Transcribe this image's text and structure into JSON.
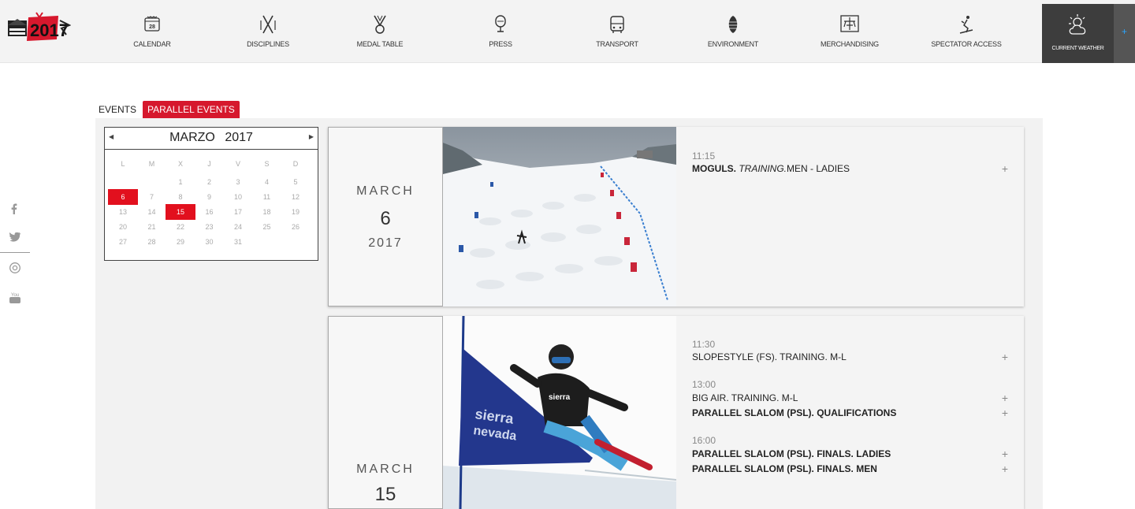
{
  "logo": {
    "text": "2017",
    "brand": "sierra nevada"
  },
  "nav": [
    {
      "label": "CALENDAR",
      "icon": "calendar-icon",
      "badge": "28"
    },
    {
      "label": "DISCIPLINES",
      "icon": "skis-icon"
    },
    {
      "label": "MEDAL TABLE",
      "icon": "medal-icon"
    },
    {
      "label": "PRESS",
      "icon": "microphone-icon"
    },
    {
      "label": "TRANSPORT",
      "icon": "bus-icon"
    },
    {
      "label": "ENVIRONMENT",
      "icon": "pinecone-icon"
    },
    {
      "label": "MERCHANDISING",
      "icon": "shop-icon"
    },
    {
      "label": "SPECTATOR ACCESS",
      "icon": "skier-icon"
    }
  ],
  "weather": {
    "label": "CURRENT WEATHER",
    "icon": "sun-cloud-icon",
    "more": "+"
  },
  "social": [
    "facebook-icon",
    "twitter-icon",
    "instagram-icon",
    "youtube-icon"
  ],
  "tabs": {
    "events": "EVENTS",
    "parallel": "PARALLEL EVENTS"
  },
  "calendar": {
    "month": "MARZO",
    "year": "2017",
    "weekdays": [
      "L",
      "M",
      "X",
      "J",
      "V",
      "S",
      "D"
    ],
    "weeks": [
      [
        "",
        "",
        "1",
        "2",
        "3",
        "4",
        "5"
      ],
      [
        "6",
        "7",
        "8",
        "9",
        "10",
        "11",
        "12"
      ],
      [
        "13",
        "14",
        "15",
        "16",
        "17",
        "18",
        "19"
      ],
      [
        "20",
        "21",
        "22",
        "23",
        "24",
        "25",
        "26"
      ],
      [
        "27",
        "28",
        "29",
        "30",
        "31",
        "",
        ""
      ]
    ],
    "highlighted": [
      "6",
      "15"
    ]
  },
  "cards": [
    {
      "month": "MARCH",
      "day": "6",
      "year": "2017",
      "groups": [
        {
          "time": "11:15",
          "items": [
            {
              "bold": "MOGULS.",
              "italic": "TRAINING.",
              "rest": "MEN - LADIES",
              "plus": "+"
            }
          ]
        }
      ]
    },
    {
      "month": "MARCH",
      "day": "15",
      "groups": [
        {
          "time": "11:30",
          "items": [
            {
              "text": "SLOPESTYLE (FS). TRAINING. M-L",
              "plus": "+"
            }
          ]
        },
        {
          "time": "13:00",
          "items": [
            {
              "text": "BIG AIR. TRAINING. M-L",
              "plus": "+"
            },
            {
              "bold": "PARALLEL SLALOM (PSL). QUALIFICATIONS",
              "plus": "+"
            }
          ]
        },
        {
          "time": "16:00",
          "items": [
            {
              "bold": "PARALLEL SLALOM (PSL). FINALS. LADIES",
              "plus": "+"
            },
            {
              "bold": "PARALLEL SLALOM (PSL). FINALS. MEN",
              "plus": "+"
            }
          ]
        }
      ]
    }
  ],
  "colors": {
    "accent": "#d6182d",
    "highlight": "#e2101e",
    "weather_bg": "#3d3d3d"
  }
}
